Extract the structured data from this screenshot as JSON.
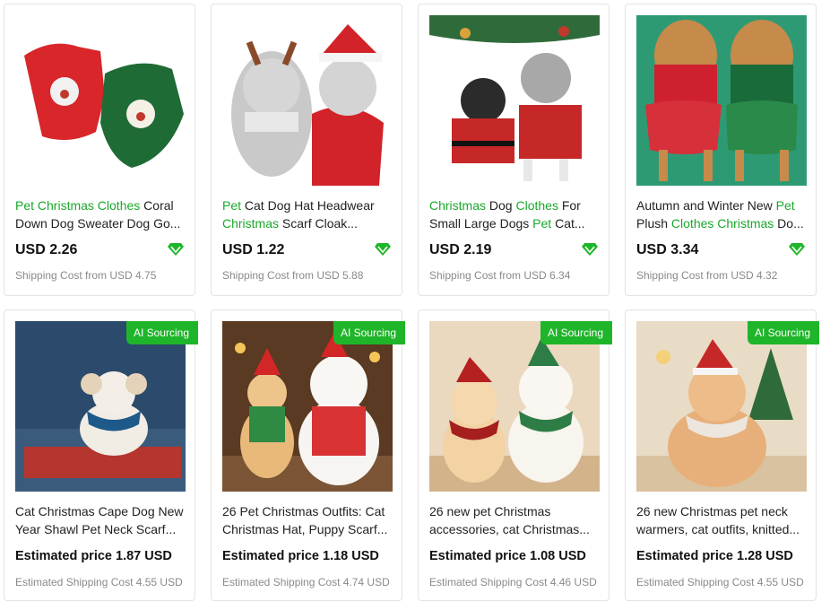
{
  "accent_color": "#1fb52a",
  "products": [
    {
      "title_line1": [
        {
          "t": "Pet Christmas Clothes",
          "hl": true
        },
        {
          "t": " Coral",
          "hl": false
        }
      ],
      "title_line2": [
        {
          "t": "Down Dog Sweater Dog Go...",
          "hl": false
        }
      ],
      "price": "USD 2.26",
      "shipping": "Shipping Cost from USD 4.75",
      "icon": "diamond-icon"
    },
    {
      "title_line1": [
        {
          "t": "Pet",
          "hl": true
        },
        {
          "t": " Cat Dog Hat Headwear",
          "hl": false
        }
      ],
      "title_line2": [
        {
          "t": "Christmas",
          "hl": true
        },
        {
          "t": " Scarf Cloak...",
          "hl": false
        }
      ],
      "price": "USD 1.22",
      "shipping": "Shipping Cost from USD 5.88",
      "icon": "diamond-icon"
    },
    {
      "title_line1": [
        {
          "t": "Christmas",
          "hl": true
        },
        {
          "t": " Dog ",
          "hl": false
        },
        {
          "t": "Clothes",
          "hl": true
        },
        {
          "t": " For",
          "hl": false
        }
      ],
      "title_line2": [
        {
          "t": "Small Large Dogs ",
          "hl": false
        },
        {
          "t": "Pet",
          "hl": true
        },
        {
          "t": " Cat...",
          "hl": false
        }
      ],
      "price": "USD 2.19",
      "shipping": "Shipping Cost from USD 6.34",
      "icon": "diamond-icon"
    },
    {
      "title_line1": [
        {
          "t": "Autumn and Winter New ",
          "hl": false
        },
        {
          "t": "Pet",
          "hl": true
        }
      ],
      "title_line2": [
        {
          "t": "Plush ",
          "hl": false
        },
        {
          "t": "Clothes Christmas",
          "hl": true
        },
        {
          "t": " Do...",
          "hl": false
        }
      ],
      "price": "USD 3.34",
      "shipping": "Shipping Cost from USD 4.32",
      "icon": "diamond-icon"
    },
    {
      "badge": "AI Sourcing",
      "title_line1": [
        {
          "t": "Cat Christmas Cape Dog New",
          "hl": false
        }
      ],
      "title_line2": [
        {
          "t": "Year Shawl Pet Neck Scarf...",
          "hl": false
        }
      ],
      "price": "Estimated price 1.87 USD",
      "shipping": "Estimated Shipping Cost 4.55 USD"
    },
    {
      "badge": "AI Sourcing",
      "title_line1": [
        {
          "t": "26 Pet Christmas Outfits: Cat",
          "hl": false
        }
      ],
      "title_line2": [
        {
          "t": "Christmas Hat, Puppy Scarf...",
          "hl": false
        }
      ],
      "price": "Estimated price 1.18 USD",
      "shipping": "Estimated Shipping Cost 4.74 USD"
    },
    {
      "badge": "AI Sourcing",
      "title_line1": [
        {
          "t": "26 new pet Christmas",
          "hl": false
        }
      ],
      "title_line2": [
        {
          "t": "accessories, cat Christmas...",
          "hl": false
        }
      ],
      "price": "Estimated price 1.08 USD",
      "shipping": "Estimated Shipping Cost 4.46 USD"
    },
    {
      "badge": "AI Sourcing",
      "title_line1": [
        {
          "t": "26 new Christmas pet neck",
          "hl": false
        }
      ],
      "title_line2": [
        {
          "t": "warmers, cat outfits, knitted...",
          "hl": false
        }
      ],
      "price": "Estimated price 1.28 USD",
      "shipping": "Estimated Shipping Cost 4.55 USD"
    }
  ]
}
